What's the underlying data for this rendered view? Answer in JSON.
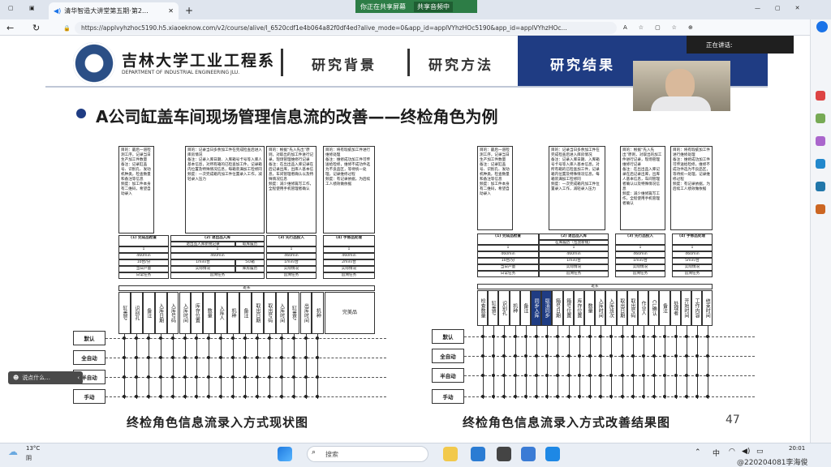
{
  "browser": {
    "tab_title": "清华智造大讲堂第五期·第2…",
    "share_status": "你正在共享屏幕",
    "share_stop": "共享音频中",
    "url": "https://applvyhzhoc5190.h5.xiaoeknow.com/v2/course/alive/l_6520cdf1e4b064a82f0df4ed?alive_mode=0&app_id=applVYhzHOc5190&app_id=applVYhzHOc..."
  },
  "header": {
    "university": "吉林大学工业工程系",
    "department": "DEPARTMENT OF INDUSTRIAL ENGINEERING JLU.",
    "nav": [
      "研究背景",
      "研究方法",
      "研究结果"
    ]
  },
  "speaking_label": "正在讲话:",
  "slide": {
    "title": "A公司缸盖车间现场管理信息流的改善——终检角色为例",
    "page_number": "47",
    "caption_left": "终检角色信息流录入方式现状图",
    "caption_right": "终检角色信息流录入方式改善结果图"
  },
  "left_diagram": {
    "desc_boxes": [
      "目的：最后一道检测工序，记录当日生产加工件数量\n备注：记录缸盖号、识别孔、发动机种类，检查数量和备注等信息\n频度：加工件本身有二维码，希望自动录入",
      "目的：记录当日多余加工件在完成检查后进入库房情况\n备注：记录入库日期、入库箱号卡号等入库人基本信息，对所有箱的已检查加工件，记录箱内位置及特殊情况信息，每箱装满加工检修同\n频度：一次完成箱内加工件位置录入工作，减轻录入压力",
      "目的：根据“先入先出”原则，对取出的加工件进行记录，现场管理维修行记录\n备注：在出出品入库记录在后记录出库，出库人基本信息，车间管理者确认以及特殊情况信息\n频度：减少维修篇写工作，全程使用手机管理者确认",
      "目的：将有瑕疵加工件进行维修处理\n备注：维修成功加工件可传送给检修，维修不成功件选为不良品区，等待统一处理，记录维修过程\n频度：有记录依据，为后续工人绩效做依据"
    ],
    "stage_headers": [
      "(1) 完成品检查",
      "(2) 退出品入库",
      "(3) 先行品投入",
      "(4) 手修品处理"
    ],
    "sub_headers": [
      "退出品入库新规记录",
      "取库履历"
    ],
    "stats": {
      "count": [
        "1",
        "1",
        "1",
        "1"
      ],
      "time": [
        "460min",
        "460min",
        "460min",
        "460min"
      ],
      "rate": [
        "10台/分",
        "1min/台",
        "5s/箱",
        "1min/台",
        "2min/台"
      ],
      "row3": [
        "当日产量",
        "实际情况",
        "库房履历",
        "实际情况",
        "实际情况"
      ],
      "row4": [
        "日常任务",
        "追溯任务",
        "追溯任务",
        "追溯任务"
      ],
      "overtime": "班长"
    },
    "fields": [
      "缸盖号",
      "识别孔",
      "备注",
      "入库日期",
      "入库号码",
      "入库时间",
      "库存位置",
      "数量",
      "入库人",
      "机种",
      "备注",
      "取出日期",
      "取出号码",
      "入库时间",
      "缸盖号",
      "出库时间",
      "机种",
      "原因",
      "CL确认",
      "工作内容",
      "完成品"
    ],
    "final_label": "完美品"
  },
  "right_diagram": {
    "desc_boxes": [
      "目的：最后一道检测工序，记录当日生产加工件数量\n备注：记录缸盖号、识别孔、发动机种类，检查数量和备注等信息\n频度：加工件本身有二维码，希望自动录入",
      "目的：记录当日多余加工件在完成检查后进入库房情况\n备注：记录入库日期、入库箱号卡号等入库人基本信息，对所有箱的已检查加工件，记录箱内位置及特殊情况信息，每箱装满加工检修同\n频度：一次完成箱内加工件位置录入工作，减轻录入压力",
      "目的：根据“先入先出”原则，对取出的加工件进行记录，现场管理维修行记录\n备注：在出出品入库记录在后记录出库，出库人基本信息，车间管理者确认以及特殊情况信息\n频度：减少维修篇写工作，全程使用手机管理者确认",
      "目的：将有瑕疵加工件进行维修处理\n备注：维修成功加工件可传送给检修，维修不成功件选为不良品区，等待统一处理，记录维修过程\n频度：有记录依据，为后续工人绩效做依据"
    ],
    "stage_headers": [
      "(1) 完成品检查",
      "(2) 退出品入库",
      "(3) 先行品投入",
      "(4) 手修品处理"
    ],
    "sub_headers": [
      "在库履历（包含新规）"
    ],
    "stats": {
      "count": [
        "1",
        "1",
        "1",
        "1"
      ],
      "time": [
        "460min",
        "460min",
        "460min",
        "460min"
      ],
      "rate": [
        "10台/分",
        "1min/台",
        "1min/台",
        "5min/台"
      ],
      "row3": [
        "当日产量",
        "实际情况",
        "实际情况",
        "实际情况"
      ],
      "row4": [
        "日常任务",
        "追溯任务",
        "追溯任务",
        "追溯任务"
      ],
      "overtime": "班长"
    },
    "fields": [
      "检查数量",
      "缸盖号",
      "识别孔",
      "机种",
      "备注",
      "同步入库",
      "取消同步",
      "箱号日期",
      "箱号位置",
      "库存位置",
      "数量",
      "入库时间",
      "入库班次",
      "取出日期",
      "取出号码",
      "作业人",
      "CL确认",
      "备注",
      "处理者",
      "开始时间",
      "工作内容",
      "结束时间"
    ]
  },
  "modes": [
    "默认",
    "全自动",
    "半自动",
    "手动"
  ],
  "chat_placeholder": "说点什么...",
  "taskbar": {
    "weather_temp": "13°C",
    "weather_text": "阴",
    "search_placeholder": "搜索",
    "lang": "中",
    "time": "20:01",
    "watermark": "@220204081李海俊"
  },
  "colors": {
    "nav_active": "#1f3c83",
    "share_green": "#2d7d46",
    "bullet": "#1f3c83"
  }
}
